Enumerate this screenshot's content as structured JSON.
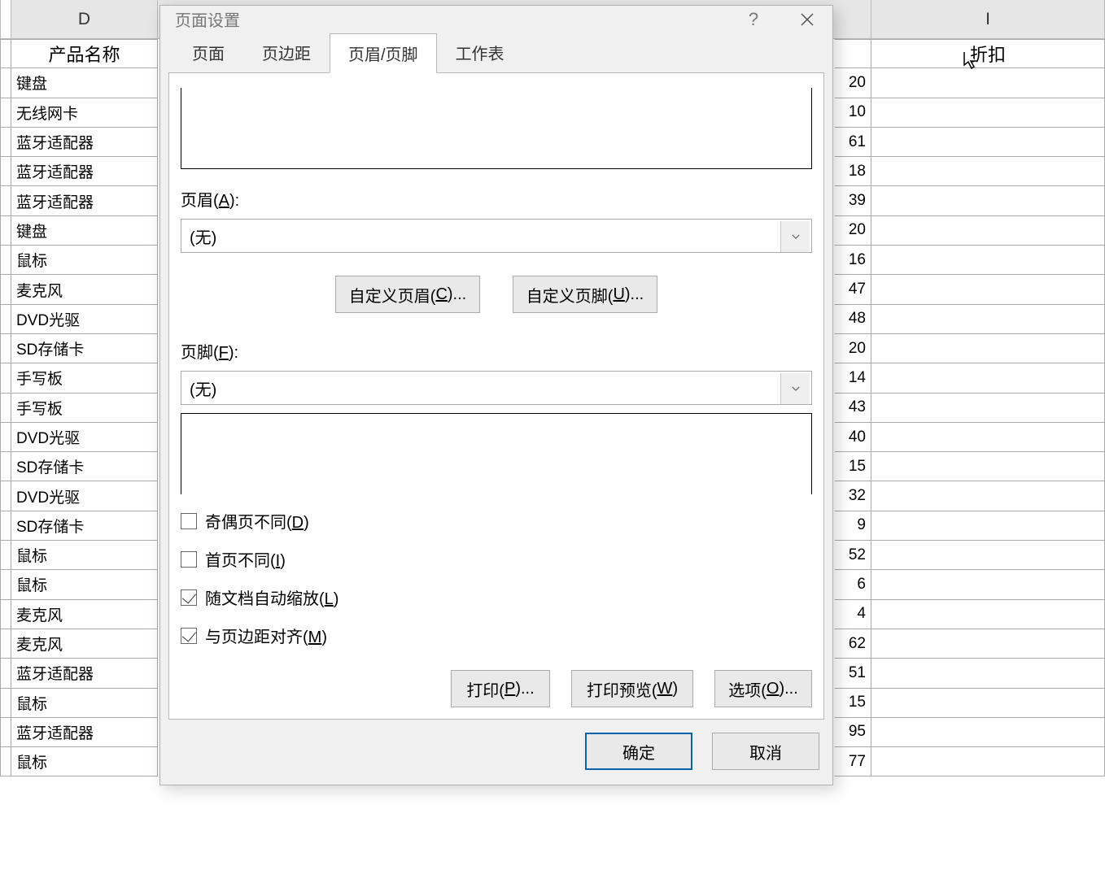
{
  "sheet": {
    "column_d_letter": "D",
    "column_i_letter": "I",
    "column_d_header": "产品名称",
    "column_i_header": "折扣",
    "rows": [
      {
        "d": "键盘",
        "i": "20"
      },
      {
        "d": "无线网卡",
        "i": "10"
      },
      {
        "d": "蓝牙适配器",
        "i": "61"
      },
      {
        "d": "蓝牙适配器",
        "i": "18"
      },
      {
        "d": "蓝牙适配器",
        "i": "39"
      },
      {
        "d": "键盘",
        "i": "20"
      },
      {
        "d": "鼠标",
        "i": "16"
      },
      {
        "d": "麦克风",
        "i": "47"
      },
      {
        "d": "DVD光驱",
        "i": "48"
      },
      {
        "d": "SD存储卡",
        "i": "20"
      },
      {
        "d": "手写板",
        "i": "14"
      },
      {
        "d": "手写板",
        "i": "43"
      },
      {
        "d": "DVD光驱",
        "i": "40"
      },
      {
        "d": "SD存储卡",
        "i": "15"
      },
      {
        "d": "DVD光驱",
        "i": "32"
      },
      {
        "d": "SD存储卡",
        "i": "9"
      },
      {
        "d": "鼠标",
        "i": "52"
      },
      {
        "d": "鼠标",
        "i": "6"
      },
      {
        "d": "麦克风",
        "i": "4"
      },
      {
        "d": "麦克风",
        "i": "62"
      },
      {
        "d": "蓝牙适配器",
        "i": "51"
      },
      {
        "d": "鼠标",
        "i": "15"
      },
      {
        "d": "蓝牙适配器",
        "i": "95"
      },
      {
        "d": "鼠标",
        "i": "77"
      }
    ]
  },
  "dialog": {
    "title": "页面设置",
    "tabs": {
      "page": "页面",
      "margins": "页边距",
      "hf": "页眉/页脚",
      "sheet": "工作表",
      "active": "hf"
    },
    "header_label_pre": "页眉(",
    "header_key": "A",
    "header_label_post": "):",
    "footer_label_pre": "页脚(",
    "footer_key": "F",
    "footer_label_post": "):",
    "header_value": "(无)",
    "footer_value": "(无)",
    "custom_header_pre": "自定义页眉(",
    "custom_header_key": "C",
    "custom_header_post": ")...",
    "custom_footer_pre": "自定义页脚(",
    "custom_footer_key": "U",
    "custom_footer_post": ")...",
    "chk_odd_pre": "奇偶页不同(",
    "chk_odd_key": "D",
    "chk_odd_post": ")",
    "chk_first_pre": "首页不同(",
    "chk_first_key": "I",
    "chk_first_post": ")",
    "chk_scale_pre": "随文档自动缩放(",
    "chk_scale_key": "L",
    "chk_scale_post": ")",
    "chk_align_pre": "与页边距对齐(",
    "chk_align_key": "M",
    "chk_align_post": ")",
    "btn_print_pre": "打印(",
    "btn_print_key": "P",
    "btn_print_post": ")...",
    "btn_preview_pre": "打印预览(",
    "btn_preview_key": "W",
    "btn_preview_post": ")",
    "btn_options_pre": "选项(",
    "btn_options_key": "O",
    "btn_options_post": ")...",
    "btn_ok": "确定",
    "btn_cancel": "取消",
    "checked": {
      "odd": false,
      "first": false,
      "scale": true,
      "align": true
    }
  }
}
